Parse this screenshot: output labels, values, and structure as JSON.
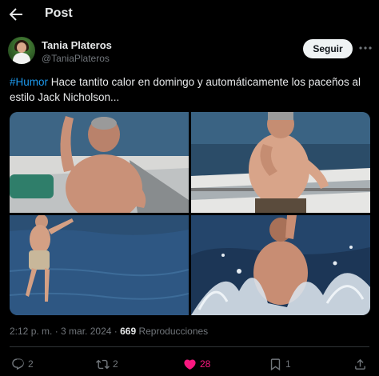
{
  "header": {
    "title": "Post"
  },
  "author": {
    "name": "Tania Plateros",
    "handle": "@TaniaPlateros"
  },
  "follow_label": "Seguir",
  "tweet": {
    "hashtag": "#Humor",
    "text": " Hace tantito calor en domingo y automáticamente los paceños al estilo Jack Nicholson..."
  },
  "meta": {
    "time": "2:12 p. m.",
    "separator": " · ",
    "date": "3 mar. 2024",
    "views_count": "669",
    "views_label": " Reproducciones"
  },
  "actions": {
    "replies": "2",
    "retweets": "2",
    "likes": "28",
    "bookmarks": "1"
  },
  "colors": {
    "background": "#000000",
    "accent": "#1d9bf0",
    "like": "#f91880",
    "muted": "#71767b"
  },
  "icons": [
    "back-arrow-icon",
    "more-icon",
    "reply-icon",
    "retweet-icon",
    "heart-icon",
    "bookmark-icon",
    "share-icon"
  ]
}
